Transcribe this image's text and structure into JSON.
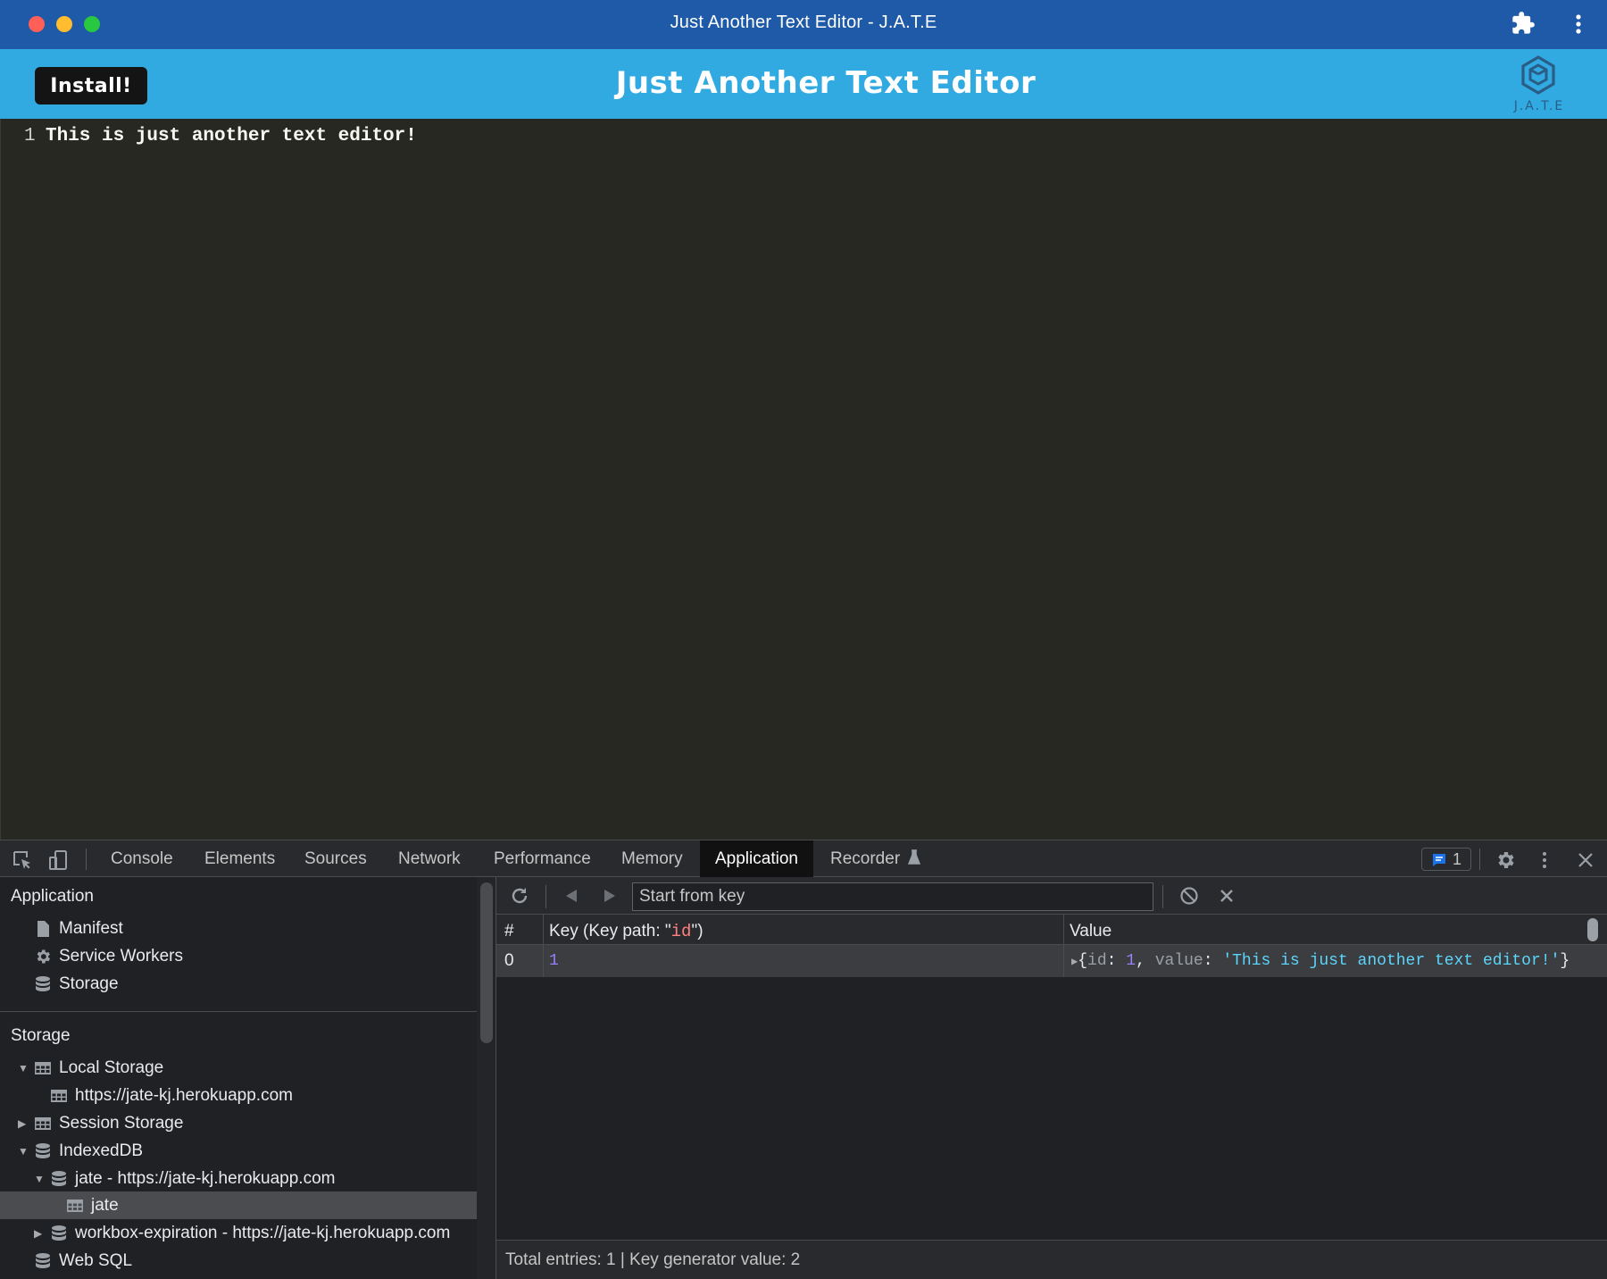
{
  "window": {
    "title": "Just Another Text Editor - J.A.T.E"
  },
  "app_header": {
    "install_label": "Install!",
    "title": "Just Another Text Editor",
    "logo_text": "J.A.T.E"
  },
  "editor": {
    "line_number": "1",
    "line_text": "This is just another text editor!"
  },
  "devtools": {
    "tabs": [
      "Console",
      "Elements",
      "Sources",
      "Network",
      "Performance",
      "Memory",
      "Application",
      "Recorder"
    ],
    "active_tab": "Application",
    "issues_count": "1",
    "sidebar": {
      "application_header": "Application",
      "application_items": [
        "Manifest",
        "Service Workers",
        "Storage"
      ],
      "storage_header": "Storage",
      "local_storage": "Local Storage",
      "local_storage_origin": "https://jate-kj.herokuapp.com",
      "session_storage": "Session Storage",
      "indexeddb": "IndexedDB",
      "db_jate": "jate - https://jate-kj.herokuapp.com",
      "store_jate": "jate",
      "db_workbox": "workbox-expiration - https://jate-kj.herokuapp.com",
      "web_sql": "Web SQL"
    },
    "data_view": {
      "start_from_key_placeholder": "Start from key",
      "columns": {
        "index": "#",
        "key_prefix": "Key (Key path: \"",
        "key_path": "id",
        "key_suffix": "\")",
        "value": "Value"
      },
      "rows": [
        {
          "index": "0",
          "key": "1",
          "value_open": "{",
          "value_id_key": "id",
          "value_id": "1",
          "value_value_key": "value",
          "value_value": "'This is just another text editor!'",
          "value_close": "}"
        }
      ],
      "status": "Total entries: 1 | Key generator value: 2"
    }
  }
}
